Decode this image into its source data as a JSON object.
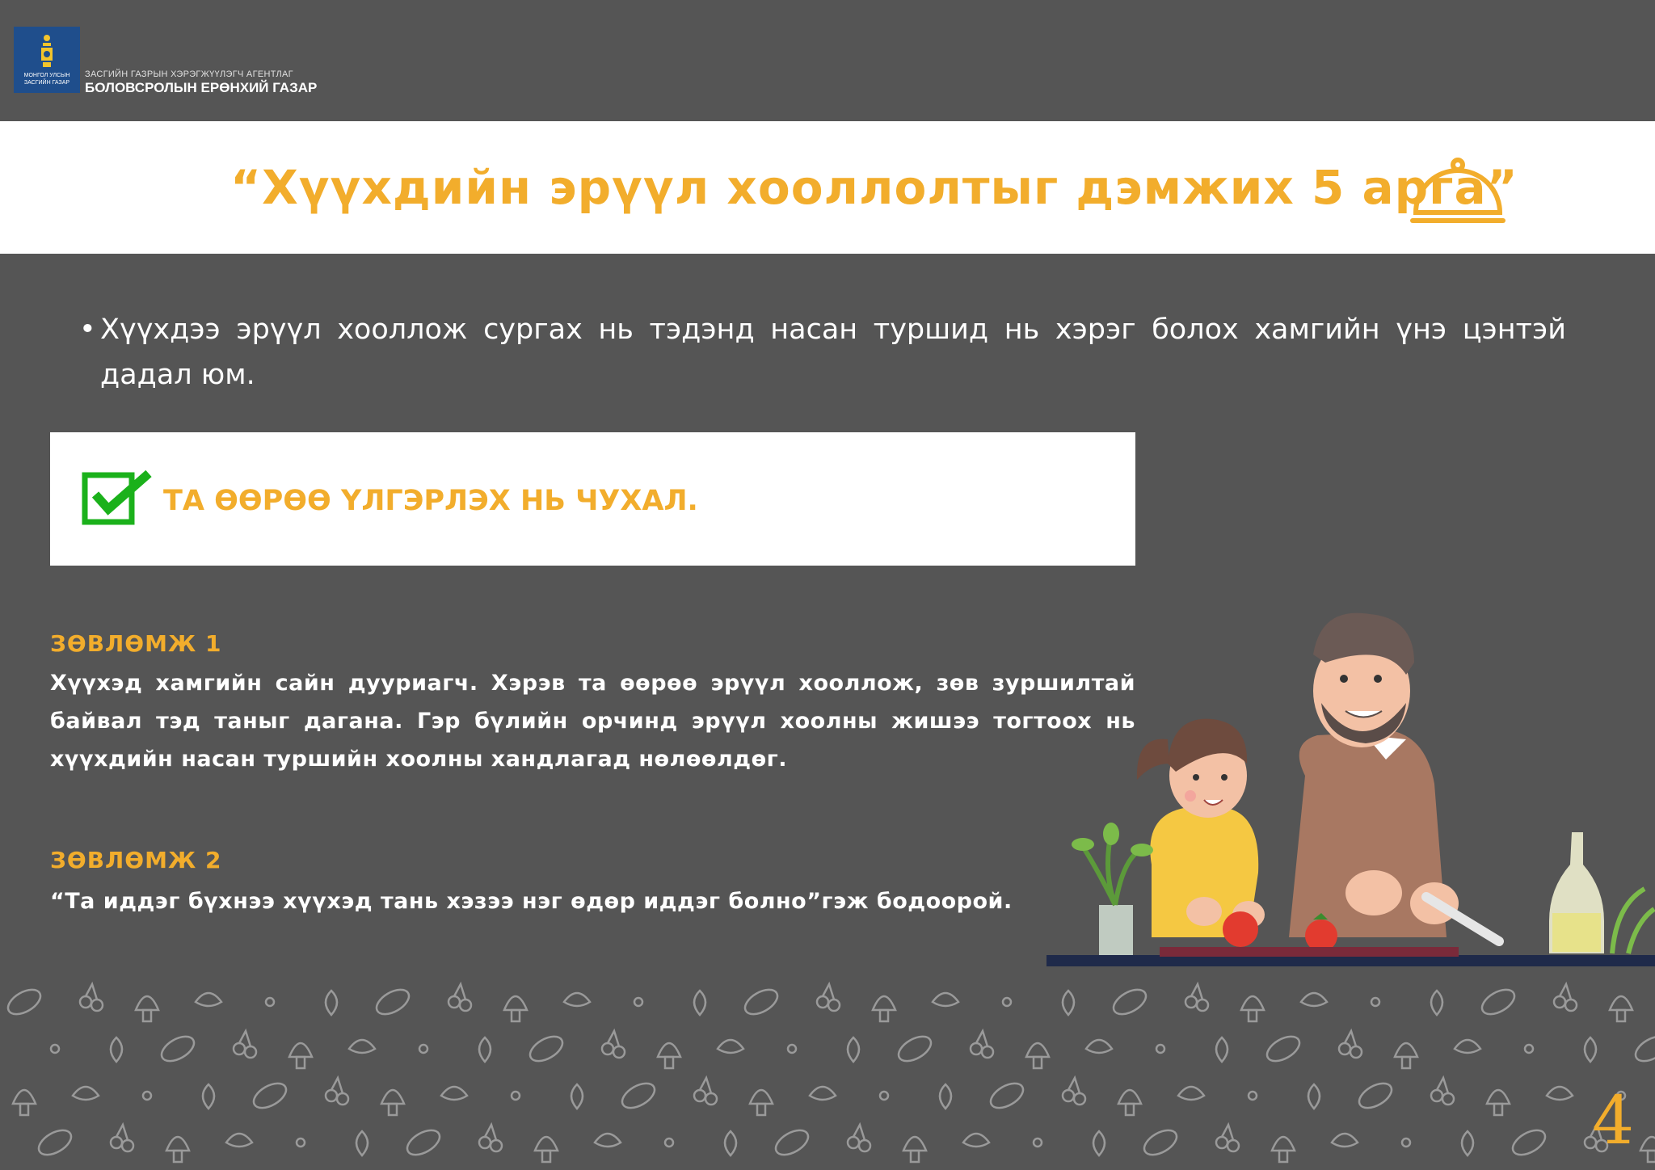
{
  "header": {
    "logo_line1": "ЗАСГИЙН ГАЗРЫН ХЭРЭГЖҮҮЛЭГЧ АГЕНТЛАГ",
    "logo_line2": "БОЛОВСРОЛЫН ЕРӨНХИЙ ГАЗАР",
    "logo_emblem": "soyombo-emblem",
    "logo_emblem_caption1": "МОНГОЛ УЛСЫН",
    "logo_emblem_caption2": "ЗАСГИЙН ГАЗАР",
    "logo_color": "#1f4e8c"
  },
  "title": {
    "text": "“Хүүхдийн эрүүл хооллолтыг дэмжих 5 арга”",
    "icon": "cloche-icon",
    "color": "#f2ad2c"
  },
  "bullet": {
    "marker": "•",
    "text": "Хүүхдээ эрүүл хооллож сургах нь тэдэнд насан туршид нь хэрэг болох хамгийн үнэ цэнтэй дадал юм."
  },
  "highlight": {
    "icon": "checkbox-checked-icon",
    "text": "ТА ӨӨРӨӨ ҮЛГЭРЛЭХ НЬ ЧУХАЛ.",
    "check_color": "#1bb11b"
  },
  "tips": [
    {
      "heading": "ЗӨВЛӨМЖ 1",
      "text": "Хүүхэд хамгийн сайн дууриагч. Хэрэв та өөрөө эрүүл хооллож, зөв зуршилтай байвал тэд таныг дагана. Гэр бүлийн орчинд эрүүл хоолны жишээ тогтоох нь хүүхдийн насан туршийн хоолны хандлагад нөлөөлдөг."
    },
    {
      "heading": "ЗӨВЛӨМЖ 2",
      "text": "“Та иддэг бүхнээ хүүхэд тань хэзээ нэг өдөр иддэг болно”гэж бодоорой."
    }
  ],
  "page_number": "4",
  "colors": {
    "background": "#555555",
    "accent": "#f2ad2c",
    "white": "#ffffff"
  }
}
